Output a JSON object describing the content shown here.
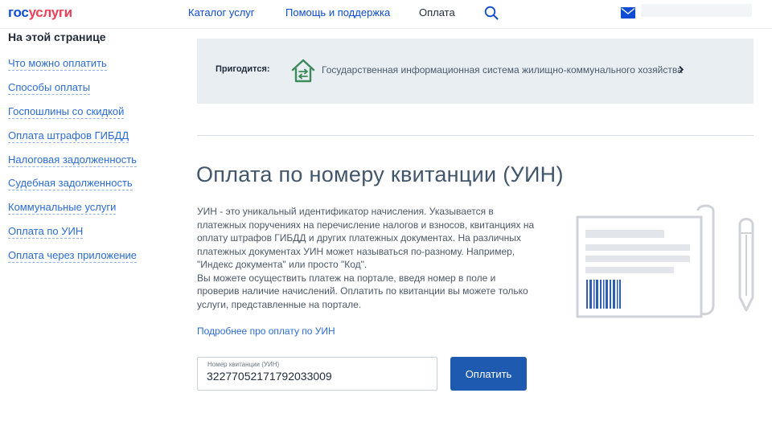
{
  "header": {
    "logo_part1": "гос",
    "logo_part2": "услуги",
    "nav": [
      {
        "label": "Каталог услуг"
      },
      {
        "label": "Помощь и поддержка"
      },
      {
        "label": "Оплата"
      }
    ]
  },
  "sidebar": {
    "title": "На этой странице",
    "items": [
      {
        "label": "Что можно оплатить"
      },
      {
        "label": "Способы оплаты"
      },
      {
        "label": "Госпошлины со скидкой"
      },
      {
        "label": "Оплата штрафов ГИБДД"
      },
      {
        "label": "Налоговая задолженность"
      },
      {
        "label": "Судебная задолженность"
      },
      {
        "label": "Коммунальные услуги"
      },
      {
        "label": "Оплата по УИН"
      },
      {
        "label": "Оплата через приложение"
      }
    ]
  },
  "banner": {
    "label": "Пригодится:",
    "link": "Государственная информационная система жилищно-коммунального хозяйства"
  },
  "main": {
    "title": "Оплата по номеру квитанции (УИН)",
    "desc_p1": "УИН - это уникальный идентификатор начисления. Указывается в платежных поручениях на перечисление налогов и взносов, квитанциях на оплату штрафов ГИБДД и других платежных документах. На различных платежных документах УИН может называться по-разному. Например, \"Индекс документа\" или просто \"Код\".",
    "desc_p2": "Вы можете осуществить платеж на портале, введя номер в поле и проверив наличие начислений. Оплатить по квитанции вы можете только услуги, представленные на портале.",
    "more_link": "Подробнее про оплату по УИН",
    "uin_label": "Номер квитанции (УИН)",
    "uin_value": "32277052171792033009",
    "pay_button": "Оплатить"
  },
  "colors": {
    "brand_blue": "#0d4cd3",
    "brand_red": "#ee3f58",
    "button": "#1d5ab0",
    "banner_bg": "#e9eef3"
  }
}
